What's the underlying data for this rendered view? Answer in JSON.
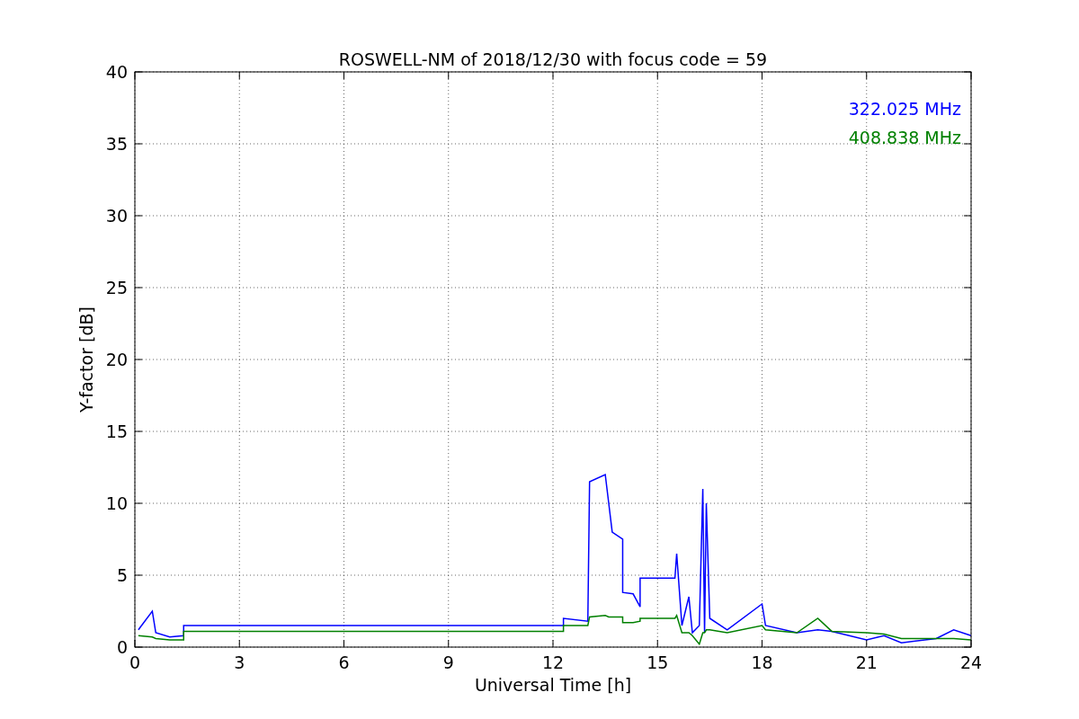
{
  "chart_data": {
    "type": "line",
    "title": "ROSWELL-NM of 2018/12/30 with focus code = 59",
    "xlabel": "Universal Time [h]",
    "ylabel": "Y-factor [dB]",
    "x": [
      0.1,
      0.5,
      0.6,
      1.0,
      1.4,
      1.4,
      12.3,
      12.3,
      13.0,
      13.05,
      13.5,
      13.6,
      13.7,
      14.0,
      14.0,
      14.3,
      14.5,
      14.5,
      15.5,
      15.55,
      15.7,
      15.9,
      16.0,
      16.2,
      16.3,
      16.35,
      16.4,
      16.5,
      17,
      18,
      18.1,
      19,
      19.6,
      20,
      21,
      21.5,
      22,
      23,
      23.5,
      24
    ],
    "series": [
      {
        "name": "322.025 MHz",
        "color": "#0000ff",
        "values": [
          1.2,
          2.5,
          1.0,
          0.7,
          0.8,
          1.5,
          1.5,
          2.0,
          1.8,
          11.5,
          12,
          10,
          8,
          7.5,
          3.8,
          3.7,
          2.8,
          4.8,
          4.8,
          6.5,
          1.5,
          3.5,
          1.0,
          1.5,
          11,
          1.0,
          10,
          2.0,
          1.2,
          3.0,
          1.5,
          1.0,
          1.2,
          1.1,
          0.5,
          0.8,
          0.3,
          0.6,
          1.2,
          0.8
        ]
      },
      {
        "name": "408.838 MHz",
        "color": "#008000",
        "values": [
          0.8,
          0.7,
          0.6,
          0.5,
          0.5,
          1.1,
          1.1,
          1.5,
          1.5,
          2.1,
          2.2,
          2.1,
          2.1,
          2.1,
          1.7,
          1.7,
          1.8,
          2.0,
          2.0,
          2.2,
          1.0,
          1.0,
          0.8,
          0.2,
          1.0,
          1.0,
          1.2,
          1.2,
          1.0,
          1.5,
          1.2,
          1.0,
          2.0,
          1.1,
          1.0,
          0.9,
          0.6,
          0.6,
          0.6,
          0.5
        ]
      }
    ],
    "xlim": [
      0,
      24
    ],
    "ylim": [
      0,
      40
    ],
    "xticks": [
      0,
      3,
      6,
      9,
      12,
      15,
      18,
      21,
      24
    ],
    "yticks": [
      0,
      5,
      10,
      15,
      20,
      25,
      30,
      35,
      40
    ],
    "grid": true
  }
}
